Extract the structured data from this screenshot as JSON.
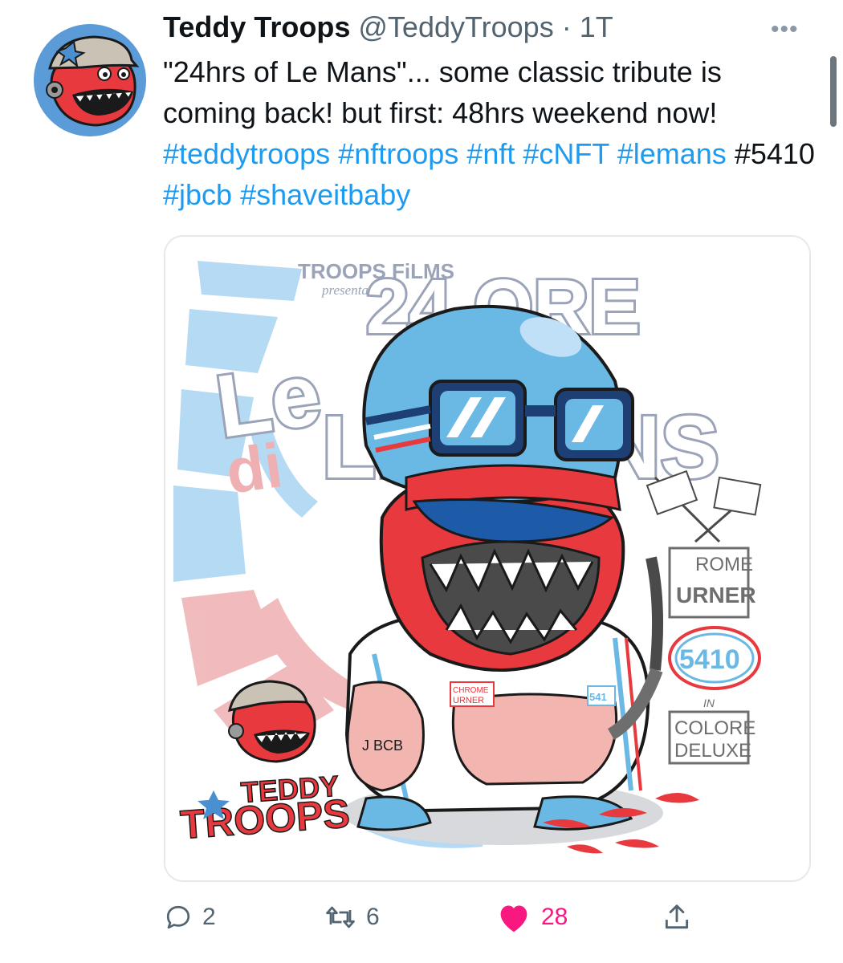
{
  "tweet": {
    "author_name": "Teddy Troops",
    "handle": "@TeddyTroops",
    "separator": "·",
    "time": "1T",
    "more_label": "•••",
    "text_parts": [
      {
        "text": "\"24hrs of Le Mans\"... some classic tribute is coming back! but first: 48hrs weekend now! ",
        "hashtag": false
      },
      {
        "text": "#teddytroops",
        "hashtag": true
      },
      {
        "text": " ",
        "hashtag": false
      },
      {
        "text": "#nftroops",
        "hashtag": true
      },
      {
        "text": " ",
        "hashtag": false
      },
      {
        "text": "#nft",
        "hashtag": true
      },
      {
        "text": " ",
        "hashtag": false
      },
      {
        "text": "#cNFT",
        "hashtag": true
      },
      {
        "text": " ",
        "hashtag": false
      },
      {
        "text": "#lemans",
        "hashtag": true
      },
      {
        "text": " #5410 ",
        "hashtag": false
      },
      {
        "text": "#jbcb",
        "hashtag": true
      },
      {
        "text": " ",
        "hashtag": false
      },
      {
        "text": "#shaveitbaby",
        "hashtag": true
      }
    ]
  },
  "media": {
    "poster": {
      "studio": "TROOPS FiLMS",
      "presents": "presenta",
      "title_le": "Le",
      "title_24ore": "24 ORE",
      "title_di": "di",
      "title_lemans": "LE MANS",
      "brand_line1": "TEDDY",
      "brand_line2": "TROOPS",
      "chrome1": "ROME",
      "chrome2": "URNER",
      "badge": "5410",
      "colore_in": "IN",
      "colore1": "COLORE",
      "colore2": "DELUXE",
      "patch1": "CHROME",
      "patch2": "URNER",
      "leg_tag": "J BCB",
      "suit_number": "541"
    }
  },
  "actions": {
    "replies": "2",
    "retweets": "6",
    "likes": "28"
  },
  "colors": {
    "hashtag": "#1d9bf0",
    "like": "#f91880",
    "muted": "#536471",
    "helmet_blue": "#6ab8e4",
    "teddy_red": "#e8393f"
  }
}
